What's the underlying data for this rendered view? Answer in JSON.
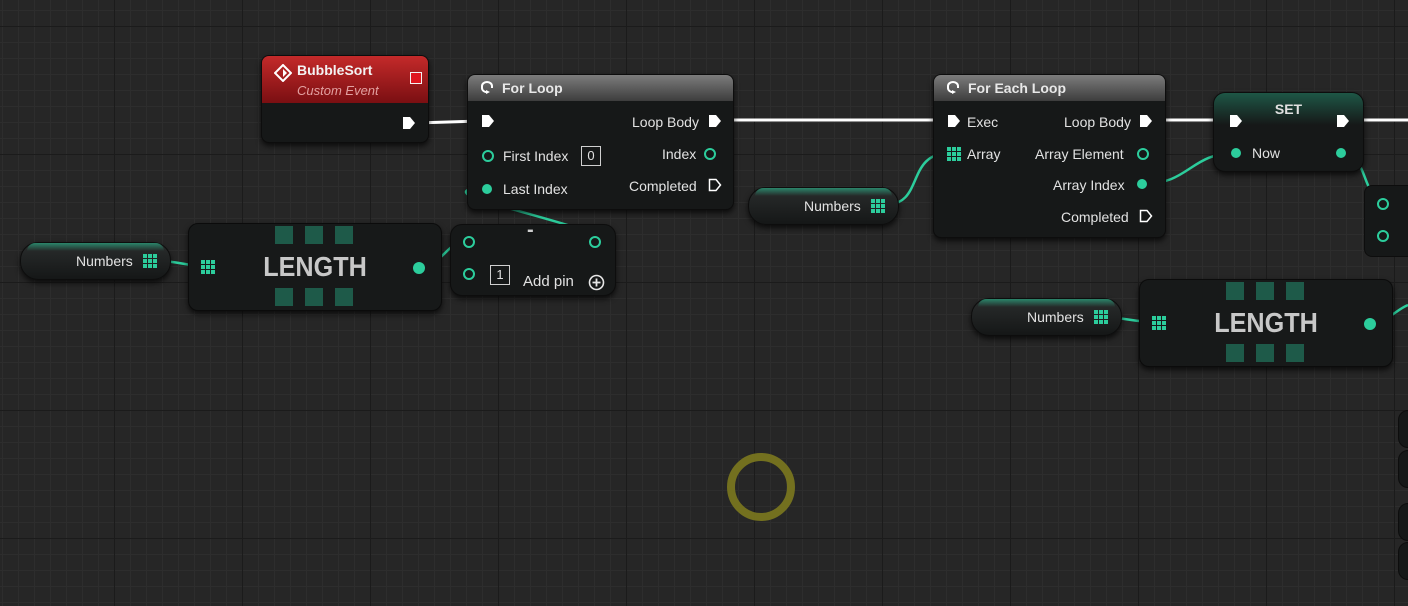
{
  "event": {
    "title": "BubbleSort",
    "subtitle": "Custom Event"
  },
  "for_loop": {
    "title": "For Loop",
    "first_index_label": "First Index",
    "first_index_value": "0",
    "last_index_label": "Last Index",
    "loop_body_label": "Loop Body",
    "index_label": "Index",
    "completed_label": "Completed"
  },
  "for_each_loop": {
    "title": "For Each Loop",
    "exec_label": "Exec",
    "array_label": "Array",
    "loop_body_label": "Loop Body",
    "array_element_label": "Array Element",
    "array_index_label": "Array Index",
    "completed_label": "Completed"
  },
  "set_node": {
    "title": "SET",
    "now_label": "Now"
  },
  "variables": {
    "numbers_1": "Numbers",
    "numbers_2": "Numbers",
    "numbers_3": "Numbers"
  },
  "length_nodes": {
    "length_1": "LENGTH",
    "length_2": "LENGTH"
  },
  "subtract_node": {
    "operator": "-",
    "value": "1",
    "add_pin_label": "Add pin",
    "add_pin_icon": "plus-circle-icon"
  },
  "colors": {
    "grid_bg": "#262626",
    "event_header": "#a3171b",
    "pin_green": "#2ccd9c",
    "exec_white": "#ffffff",
    "cursor_ring": "#77741f"
  }
}
